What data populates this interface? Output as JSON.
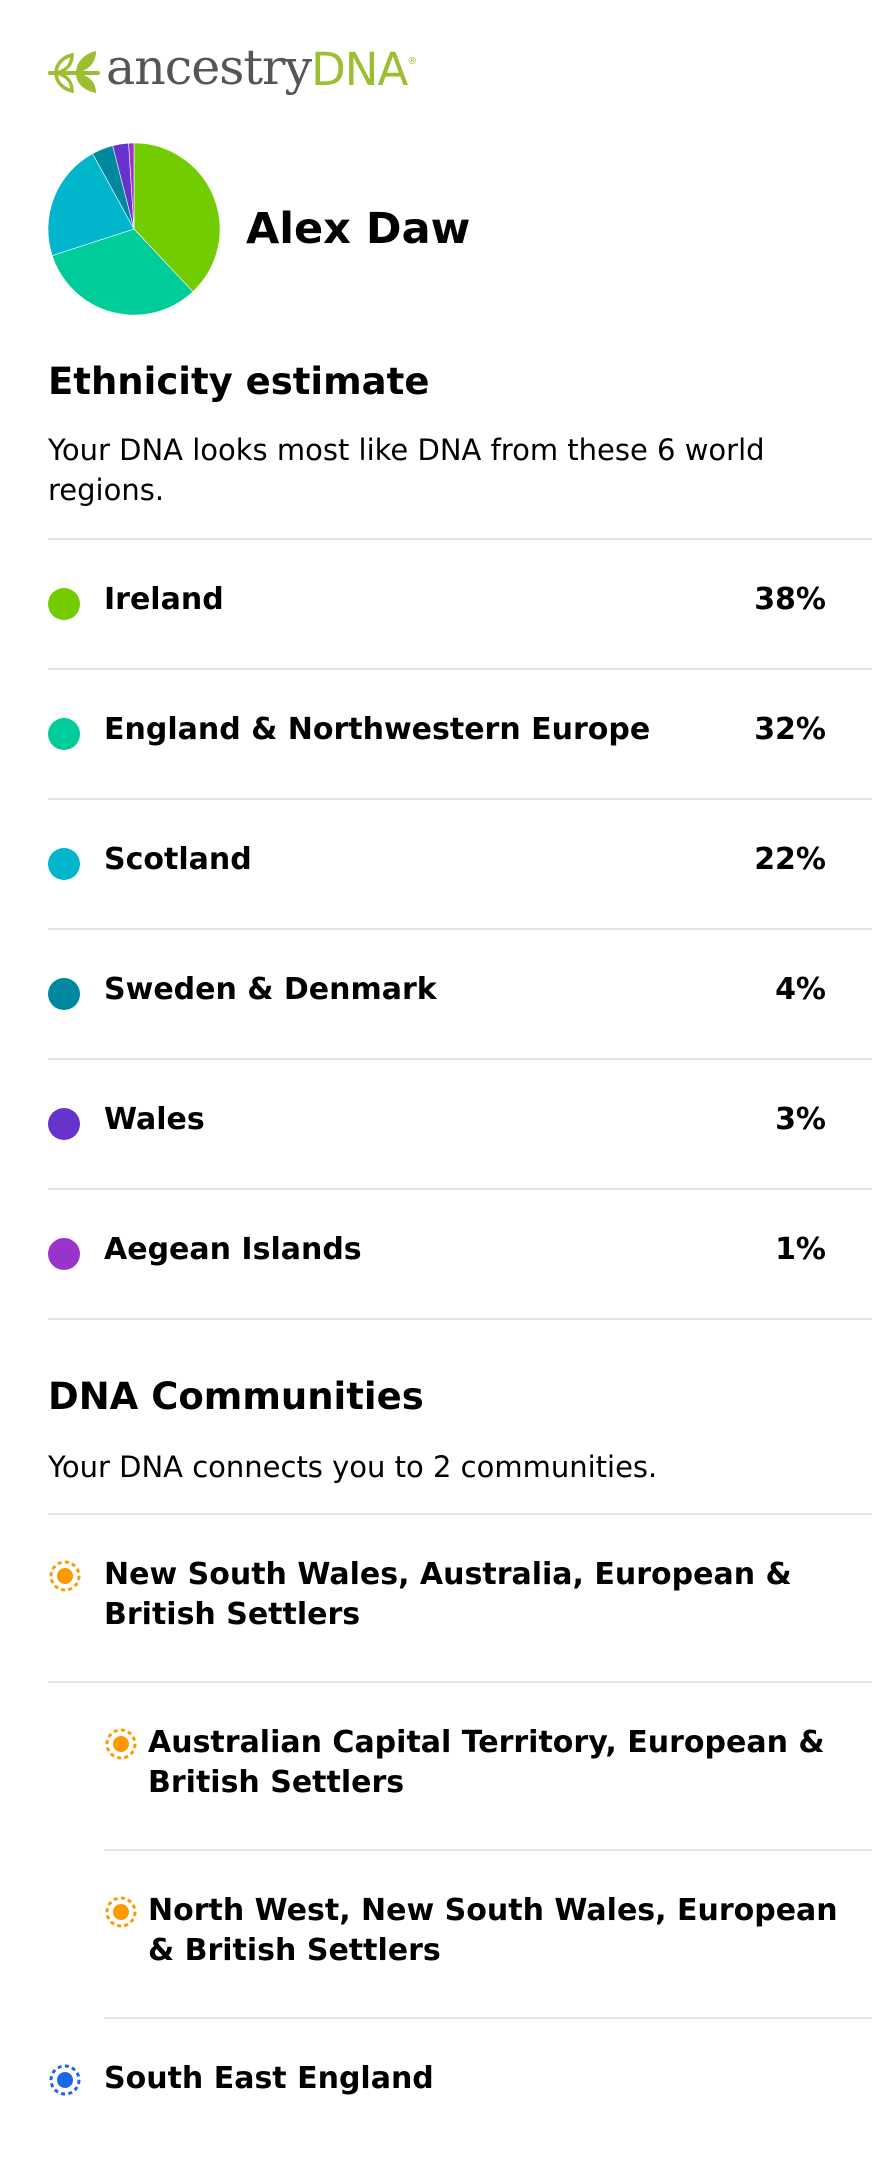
{
  "brand": {
    "name": "ancestry",
    "product": "DNA",
    "registered": "®",
    "colors": {
      "logo_green": "#9cbe30",
      "logo_grey": "#555555"
    }
  },
  "profile": {
    "name": "Alex Daw"
  },
  "ethnicity": {
    "title": "Ethnicity estimate",
    "description": "Your DNA looks most like DNA from these 6 world regions.",
    "regions": [
      {
        "name": "Ireland",
        "percent_label": "38%",
        "percent": 38,
        "color": "#72cc00"
      },
      {
        "name": "England & Northwestern Europe",
        "percent_label": "32%",
        "percent": 32,
        "color": "#00cc99"
      },
      {
        "name": "Scotland",
        "percent_label": "22%",
        "percent": 22,
        "color": "#00b5cc"
      },
      {
        "name": "Sweden & Denmark",
        "percent_label": "4%",
        "percent": 4,
        "color": "#00889e"
      },
      {
        "name": "Wales",
        "percent_label": "3%",
        "percent": 3,
        "color": "#6633cc"
      },
      {
        "name": "Aegean Islands",
        "percent_label": "1%",
        "percent": 1,
        "color": "#9933cc"
      }
    ]
  },
  "communities": {
    "title": "DNA Communities",
    "description": "Your DNA connects you to 2 communities.",
    "groups": [
      {
        "name": "New South Wales, Australia, European & British Settlers",
        "icon": "community-dot-icon",
        "color": "#ff9900",
        "subgroups": [
          {
            "name": "Australian Capital Territory, European & British Settlers",
            "icon": "community-dot-icon",
            "color": "#ff9900"
          },
          {
            "name": "North West, New South Wales, European & British Settlers",
            "icon": "community-dot-icon",
            "color": "#ff9900"
          }
        ]
      },
      {
        "name": "South East England",
        "icon": "community-dot-icon",
        "color": "#1a66e6",
        "subgroups": []
      }
    ]
  }
}
